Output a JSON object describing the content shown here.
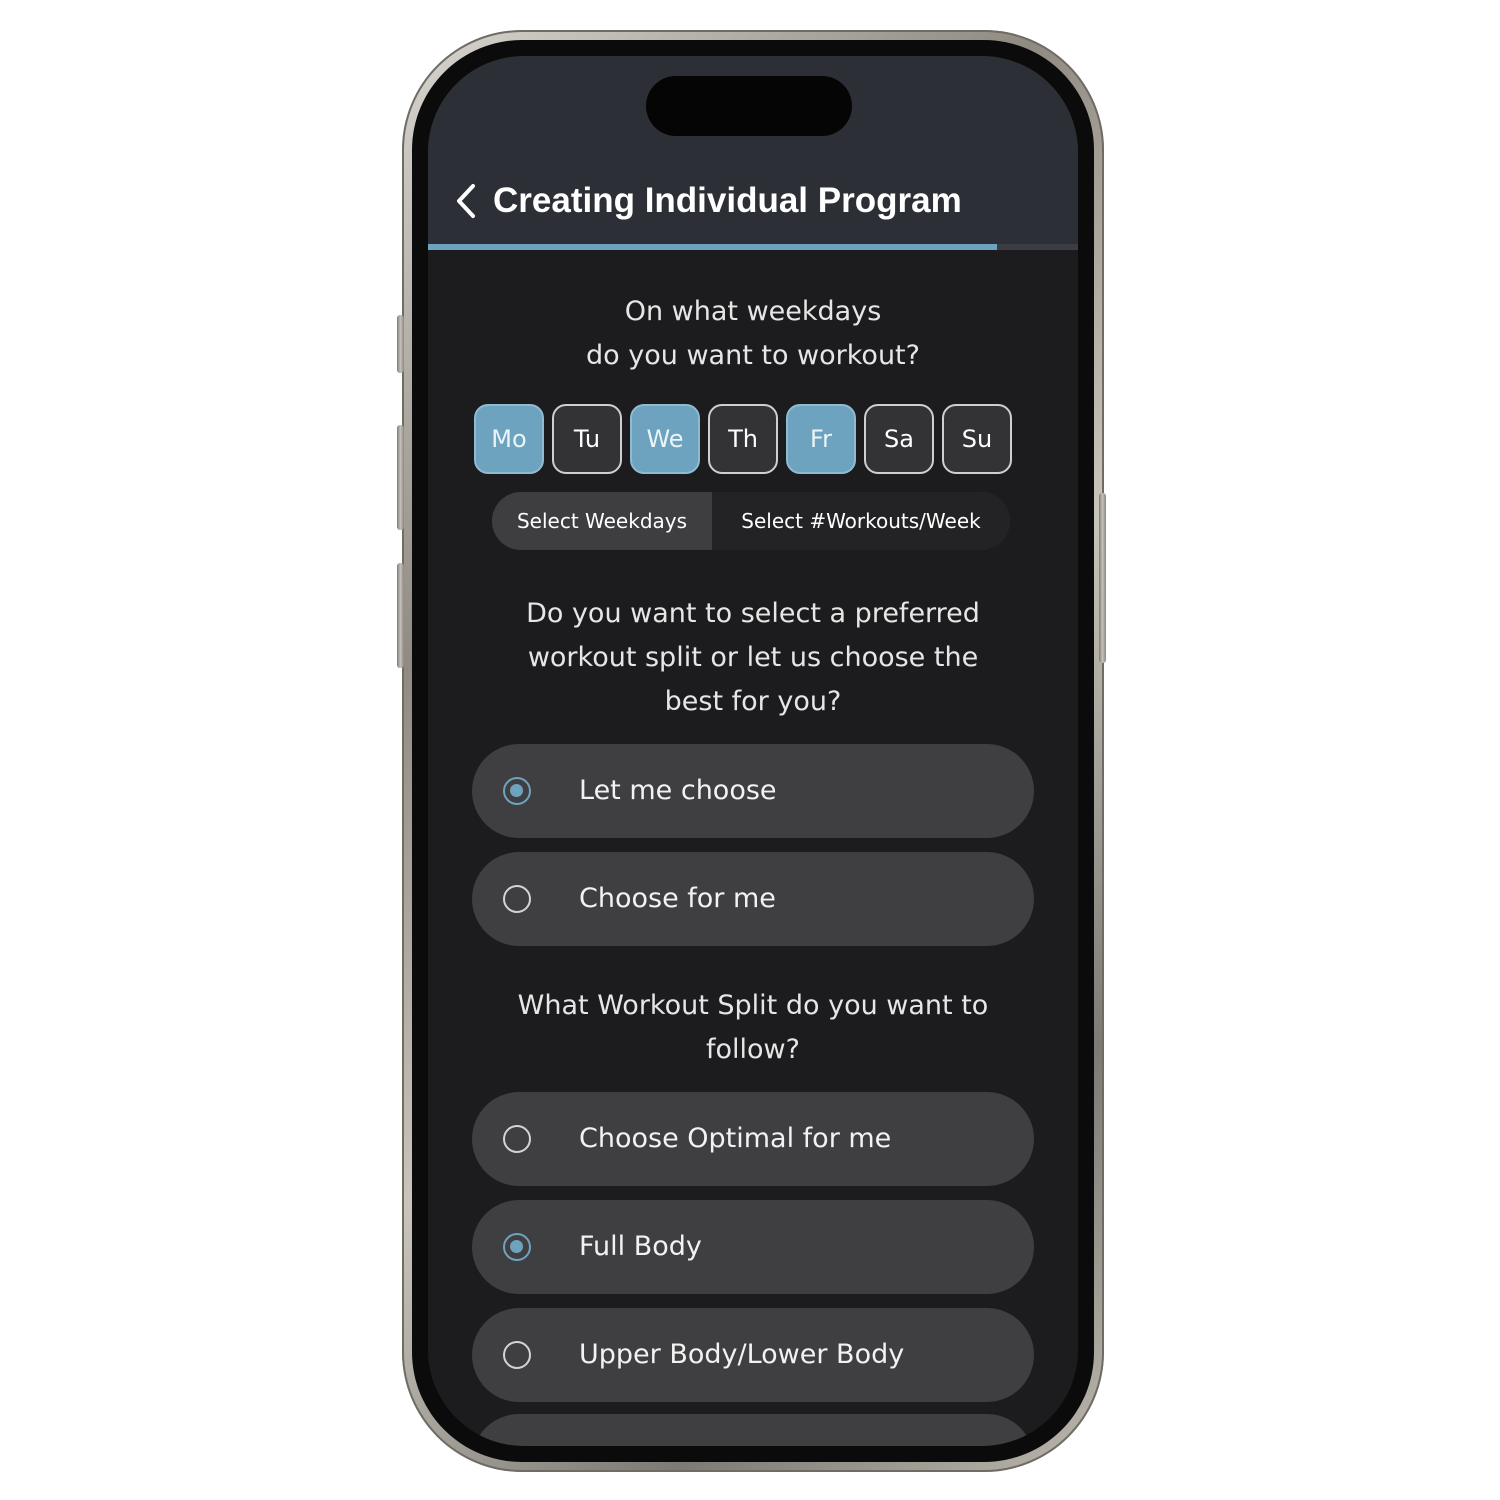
{
  "header": {
    "title": "Creating Individual Program",
    "progress": 0.875
  },
  "weekdays": {
    "question_line1": "On what weekdays",
    "question_line2": "do you want to workout?",
    "days": [
      {
        "label": "Mo",
        "selected": true
      },
      {
        "label": "Tu",
        "selected": false
      },
      {
        "label": "We",
        "selected": true
      },
      {
        "label": "Th",
        "selected": false
      },
      {
        "label": "Fr",
        "selected": true
      },
      {
        "label": "Sa",
        "selected": false
      },
      {
        "label": "Su",
        "selected": false
      }
    ],
    "mode_selected": "Select Weekdays",
    "mode_other": "Select #Workouts/Week"
  },
  "split_pref": {
    "question_line1": "Do you want to select a preferred",
    "question_line2": "workout split or let us choose the",
    "question_line3": "best for you?",
    "options": [
      {
        "label": "Let me choose",
        "selected": true
      },
      {
        "label": "Choose for me",
        "selected": false
      }
    ]
  },
  "split": {
    "question_line1": "What Workout Split do you want to",
    "question_line2": "follow?",
    "options": [
      {
        "label": "Choose Optimal for me",
        "selected": false
      },
      {
        "label": "Full Body",
        "selected": true
      },
      {
        "label": "Upper Body/Lower Body",
        "selected": false
      }
    ]
  },
  "colors": {
    "accent": "#6ea3bf",
    "screen_bg": "#1c1c1e",
    "header_bg": "#2c3036",
    "option_bg": "#3f3f42"
  },
  "icons": {
    "back": "chevron-left-icon"
  }
}
